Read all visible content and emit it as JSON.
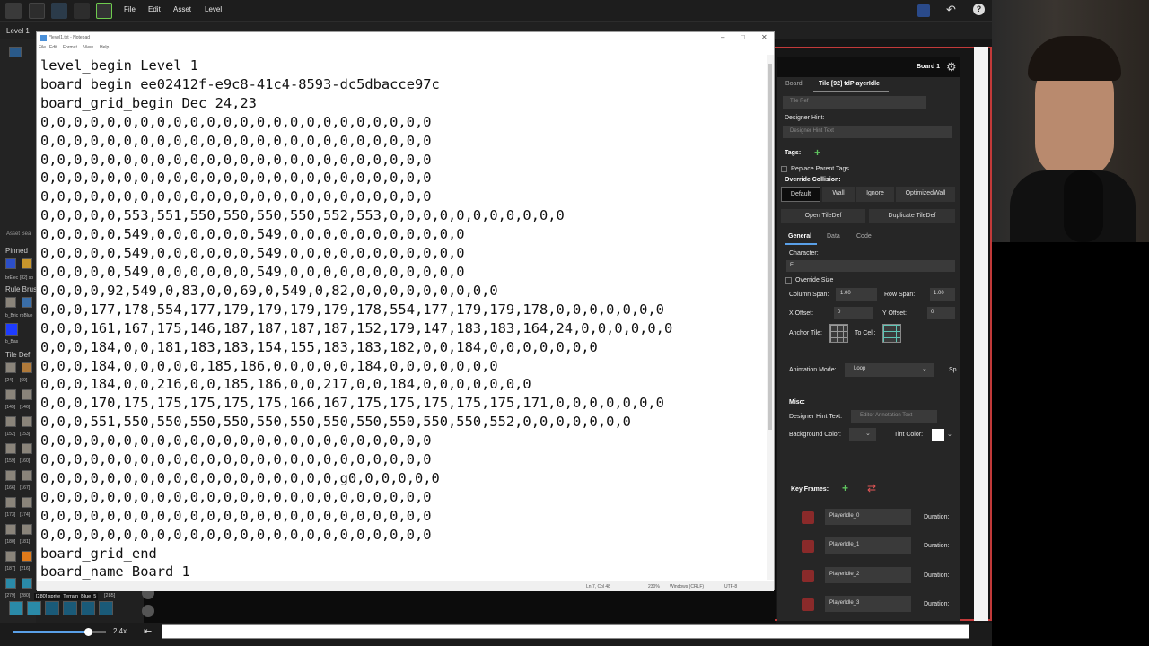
{
  "topbar": {
    "menus": [
      "File",
      "Edit",
      "Asset",
      "Level"
    ]
  },
  "level_tab": "Level 1",
  "left_panel": {
    "asset_search": "Asset Sea",
    "pinned": "Pinned",
    "pinned_items": [
      "brElec",
      "[82] sp"
    ],
    "rule_brush": "Rule Brus",
    "rule_items": [
      "b_Bric",
      "rbBlue"
    ],
    "bbas": "b_Bas",
    "tile_def": "Tile Def",
    "tile_ids": [
      "[24]",
      "[69]",
      "[145]",
      "[146]",
      "[152]",
      "[153]",
      "[159]",
      "[160]",
      "[166]",
      "[167]",
      "[173]",
      "[174]",
      "[180]",
      "[181]",
      "[187]",
      "[216]",
      "[279]",
      "[280]"
    ],
    "sprite_label": "[280] sprite_Terrain_Blue_5",
    "sprite_id2": "[285]"
  },
  "notepad": {
    "title": "*level1.txt - Notepad",
    "menu": [
      "File",
      "Edit",
      "Format",
      "View",
      "Help"
    ],
    "lines": [
      "level_begin Level 1",
      "board_begin ee02412f-e9c8-41c4-8593-dc5dbacce97c",
      "board_grid_begin Dec 24,23",
      "0,0,0,0,0,0,0,0,0,0,0,0,0,0,0,0,0,0,0,0,0,0,0,0",
      "0,0,0,0,0,0,0,0,0,0,0,0,0,0,0,0,0,0,0,0,0,0,0,0",
      "0,0,0,0,0,0,0,0,0,0,0,0,0,0,0,0,0,0,0,0,0,0,0,0",
      "0,0,0,0,0,0,0,0,0,0,0,0,0,0,0,0,0,0,0,0,0,0,0,0",
      "0,0,0,0,0,0,0,0,0,0,0,0,0,0,0,0,0,0,0,0,0,0,0,0",
      "0,0,0,0,0,553,551,550,550,550,550,552,553,0,0,0,0,0,0,0,0,0,0,0",
      "0,0,0,0,0,549,0,0,0,0,0,0,549,0,0,0,0,0,0,0,0,0,0,0",
      "0,0,0,0,0,549,0,0,0,0,0,0,549,0,0,0,0,0,0,0,0,0,0,0",
      "0,0,0,0,0,549,0,0,0,0,0,0,549,0,0,0,0,0,0,0,0,0,0,0",
      "0,0,0,0,92,549,0,83,0,0,69,0,549,0,82,0,0,0,0,0,0,0,0,0",
      "0,0,0,177,178,554,177,179,179,179,179,178,554,177,179,179,178,0,0,0,0,0,0,0",
      "0,0,0,161,167,175,146,187,187,187,187,152,179,147,183,183,164,24,0,0,0,0,0,0",
      "0,0,0,184,0,0,181,183,183,154,155,183,183,182,0,0,184,0,0,0,0,0,0,0",
      "0,0,0,184,0,0,0,0,0,185,186,0,0,0,0,0,184,0,0,0,0,0,0,0",
      "0,0,0,184,0,0,216,0,0,185,186,0,0,217,0,0,184,0,0,0,0,0,0,0",
      "0,0,0,170,175,175,175,175,175,166,167,175,175,175,175,175,171,0,0,0,0,0,0,0",
      "0,0,0,551,550,550,550,550,550,550,550,550,550,550,550,552,0,0,0,0,0,0,0",
      "0,0,0,0,0,0,0,0,0,0,0,0,0,0,0,0,0,0,0,0,0,0,0,0",
      "0,0,0,0,0,0,0,0,0,0,0,0,0,0,0,0,0,0,0,0,0,0,0,0",
      "0,0,0,0,0,0,0,0,0,0,0,0,0,0,0,0,0,0,g0,0,0,0,0,0",
      "0,0,0,0,0,0,0,0,0,0,0,0,0,0,0,0,0,0,0,0,0,0,0,0",
      "0,0,0,0,0,0,0,0,0,0,0,0,0,0,0,0,0,0,0,0,0,0,0,0",
      "0,0,0,0,0,0,0,0,0,0,0,0,0,0,0,0,0,0,0,0,0,0,0,0",
      "board_grid_end",
      "board_name Board 1"
    ],
    "status": {
      "position": "Ln 7, Col 48",
      "zoom": "230%",
      "line_ending": "Windows (CRLF)",
      "encoding": "UTF-8"
    }
  },
  "inspector": {
    "board_title": "Board 1",
    "tabs": [
      "Board",
      "Tile [92] tdPlayerIdle"
    ],
    "tile_ref_placeholder": "Tile Ref",
    "designer_hint_label": "Designer Hint:",
    "designer_hint_placeholder": "Designer Hint Text",
    "tags_label": "Tags:",
    "replace_parent_tags": "Replace Parent Tags",
    "override_collision": "Override Collision:",
    "collision_options": [
      "Default",
      "Wall",
      "Ignore",
      "OptimizedWall"
    ],
    "open_tiledef": "Open TileDef",
    "duplicate_tiledef": "Duplicate TileDef",
    "sub_tabs": [
      "General",
      "Data",
      "Code"
    ],
    "character_label": "Character:",
    "character_value": "E",
    "override_size": "Override Size",
    "column_span_label": "Column Span:",
    "column_span": "1.00",
    "row_span_label": "Row Span:",
    "row_span": "1.00",
    "x_offset_label": "X Offset:",
    "x_offset": "0",
    "y_offset_label": "Y Offset:",
    "y_offset": "0",
    "anchor_tile_label": "Anchor Tile:",
    "to_cell_label": "To Cell:",
    "animation_mode_label": "Animation Mode:",
    "animation_mode": "Loop",
    "animation_extra": "Sp",
    "misc_label": "Misc:",
    "designer_hint_text_label": "Designer Hint Text:",
    "editor_annotation_placeholder": "Editor Annotation Text",
    "background_color_label": "Background Color:",
    "tint_color_label": "Tint Color:",
    "key_frames_label": "Key Frames:",
    "key_frames": [
      {
        "name": "PlayerIdle_0",
        "duration_label": "Duration:"
      },
      {
        "name": "PlayerIdle_1",
        "duration_label": "Duration:"
      },
      {
        "name": "PlayerIdle_2",
        "duration_label": "Duration:"
      },
      {
        "name": "PlayerIdle_3",
        "duration_label": "Duration:"
      }
    ]
  },
  "bottom": {
    "zoom": "2.4x"
  },
  "colors": {
    "accent_green": "#5ec45e",
    "selection_blue": "#5aa0e8",
    "red_border": "#c23a3a"
  }
}
